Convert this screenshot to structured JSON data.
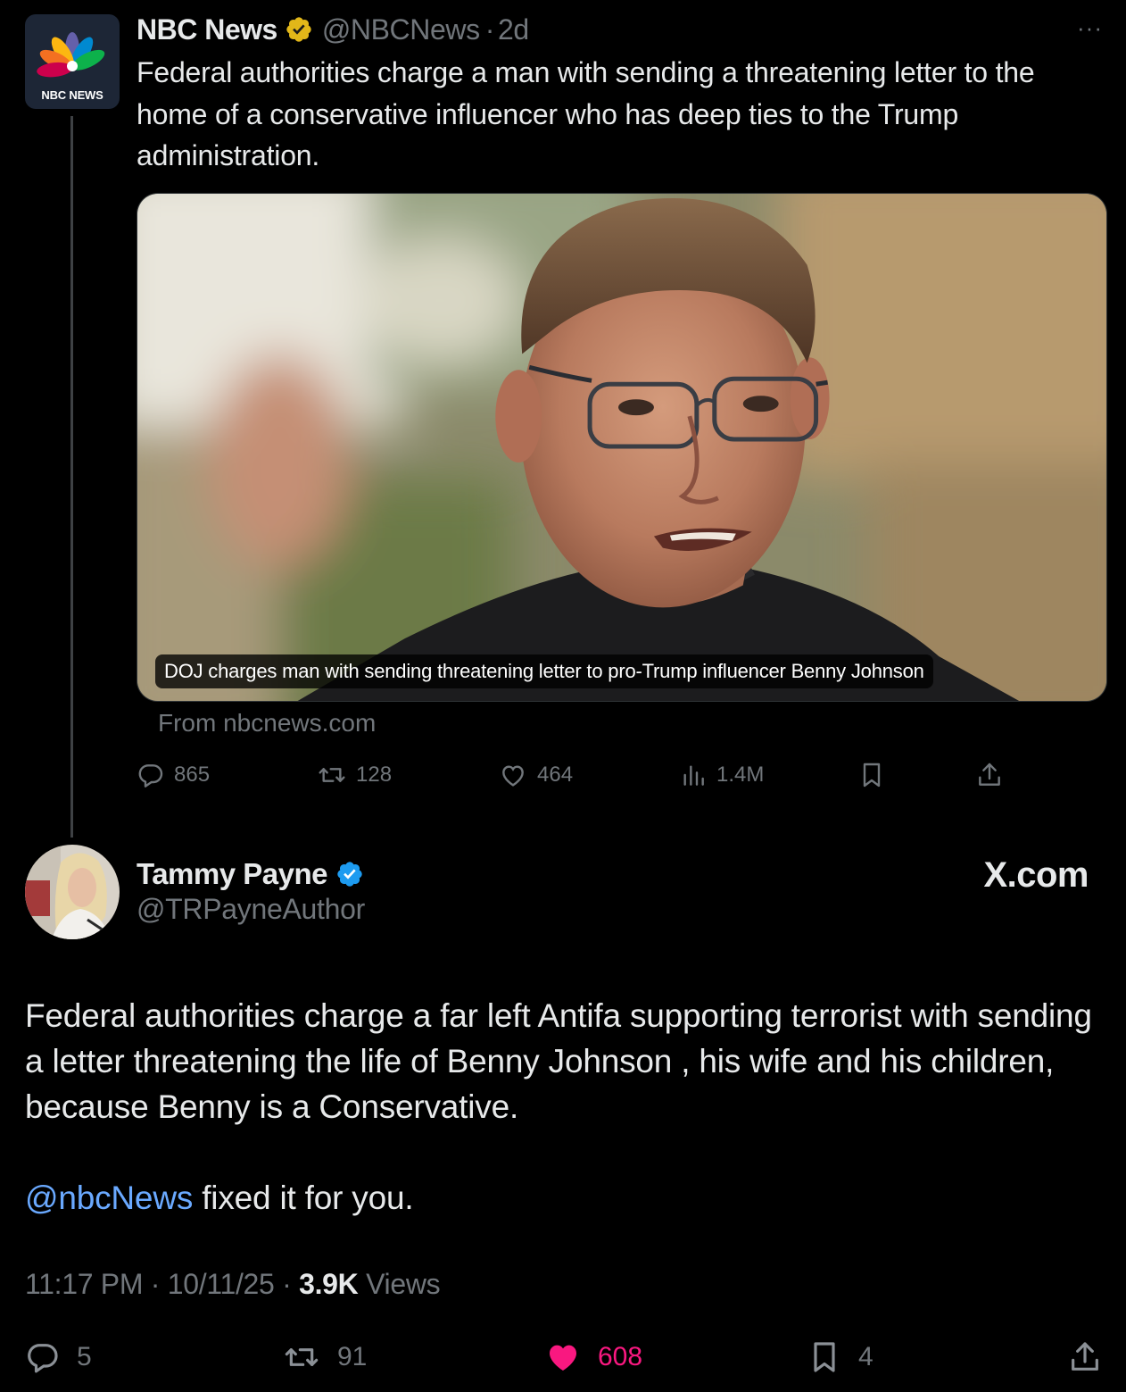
{
  "parent_tweet": {
    "logo_text": "NBC NEWS",
    "display_name": "NBC News",
    "handle": "@NBCNews",
    "time_separator": "·",
    "time": "2d",
    "more_label": "···",
    "text": "Federal authorities charge a man with sending a threatening letter to the home of a conservative influencer who has deep ties to the Trump administration.",
    "card": {
      "caption": "DOJ charges man with sending threatening letter to pro-Trump influencer Benny Johnson",
      "source": "From nbcnews.com"
    },
    "actions": {
      "replies": "865",
      "reposts": "128",
      "likes": "464",
      "views": "1.4M"
    }
  },
  "main_tweet": {
    "display_name": "Tammy Payne",
    "handle": "@TRPayneAuthor",
    "watermark": "X.com",
    "paragraph_1": "Federal authorities charge a far left Antifa supporting terrorist with sending a letter threatening the life of Benny Johnson , his wife and his children, because Benny is a Conservative.",
    "mention": "@nbcNews",
    "paragraph_2_rest": " fixed it for you.",
    "meta": {
      "time": "11:17 PM",
      "sep1": " · ",
      "date": "10/11/25",
      "sep2": " · ",
      "views_count": "3.9K",
      "views_label": " Views"
    },
    "actions": {
      "replies": "5",
      "reposts": "91",
      "likes": "608",
      "bookmarks": "4"
    }
  },
  "colors": {
    "background": "#000000",
    "text_primary": "#e7e9ea",
    "text_secondary": "#71767b",
    "mention": "#6aa9ff",
    "like_active": "#f91880",
    "verified_blue": "#1d9bf0",
    "verified_gold": "#e2b719"
  }
}
